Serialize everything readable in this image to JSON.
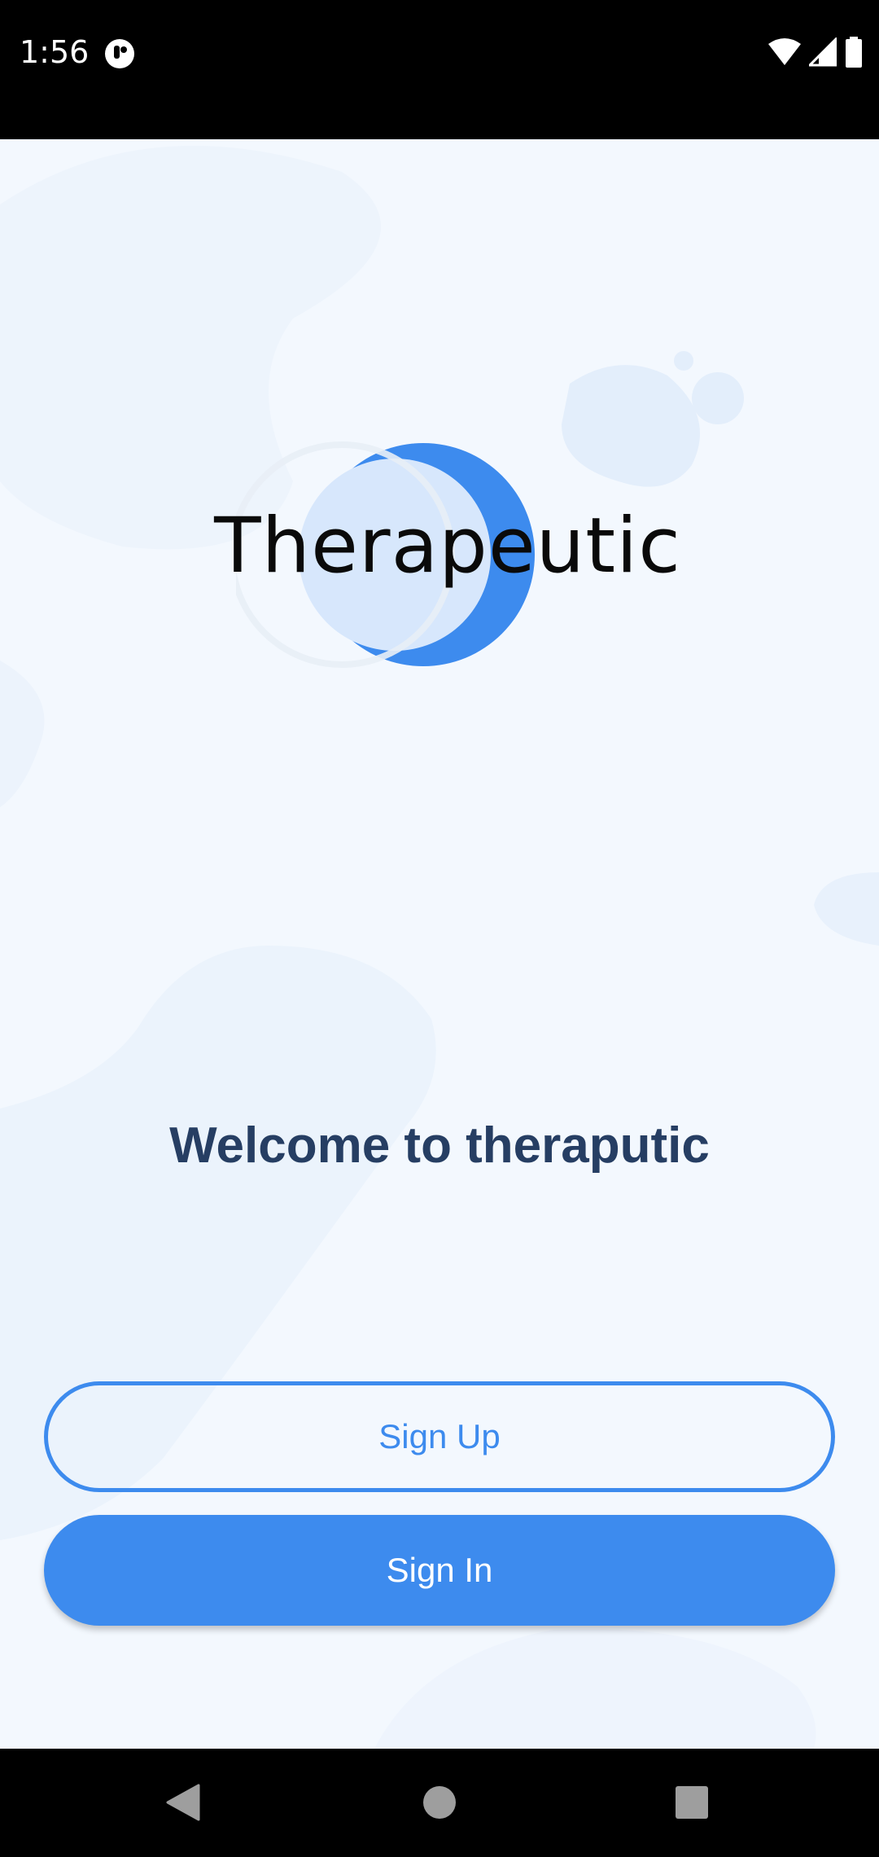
{
  "status_bar": {
    "time": "1:56",
    "icons": [
      "notification-app-icon",
      "wifi-icon",
      "cell-signal-icon",
      "battery-icon"
    ]
  },
  "app": {
    "logo_text": "Therapeutic",
    "welcome_text": "Welcome to theraputic",
    "signup_label": "Sign Up",
    "signin_label": "Sign In"
  },
  "nav_bar": {
    "icons": [
      "back-icon",
      "home-icon",
      "recents-icon"
    ]
  },
  "colors": {
    "accent": "#3d8bee",
    "heading": "#263e63",
    "background": "#f3f8fe",
    "logo_light": "#d7e7fc"
  }
}
